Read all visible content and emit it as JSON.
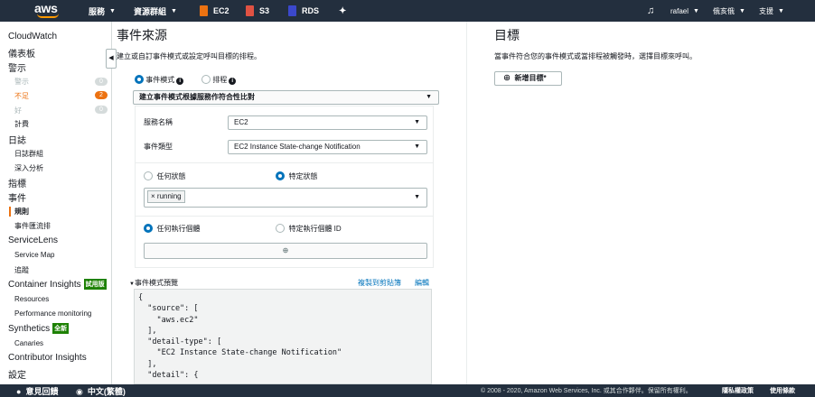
{
  "topbar": {
    "logo": "aws",
    "services": "服務",
    "resource_groups": "資源群組",
    "pins": [
      {
        "label": "EC2",
        "color": "#ec7211"
      },
      {
        "label": "S3",
        "color": "#e05243"
      },
      {
        "label": "RDS",
        "color": "#3b48cc"
      }
    ],
    "user": "rafael",
    "region": "俄亥俄",
    "support": "支援"
  },
  "sidebar": {
    "cloudwatch": "CloudWatch",
    "dashboards": "儀表板",
    "alarms": "警示",
    "alarm_states": [
      {
        "label": "警示",
        "count": "0"
      },
      {
        "label": "不足",
        "count": "2"
      },
      {
        "label": "好",
        "count": "0"
      }
    ],
    "billing": "計費",
    "logs": "日誌",
    "log_groups": "日誌群組",
    "insights": "深入分析",
    "metrics": "指標",
    "events": "事件",
    "rules": "規則",
    "event_buses": "事件匯流排",
    "servicelens": "ServiceLens",
    "service_map": "Service Map",
    "traces": "追蹤",
    "container_insights": "Container Insights",
    "container_badge": "試用版",
    "resources": "Resources",
    "performance_monitoring": "Performance monitoring",
    "synthetics": "Synthetics",
    "synthetics_badge": "全新",
    "canaries": "Canaries",
    "contributor_insights": "Contributor Insights",
    "settings": "設定"
  },
  "source": {
    "title": "事件來源",
    "description": "建立或自訂事件模式或設定呼叫目標的排程。",
    "option_pattern": "事件模式",
    "option_schedule": "排程",
    "pattern_select": "建立事件模式根據服務作符合性比對",
    "service_name_label": "服務名稱",
    "service_name_value": "EC2",
    "event_type_label": "事件類型",
    "event_type_value": "EC2 Instance State-change Notification",
    "any_state": "任何狀態",
    "specific_state": "特定狀態",
    "state_token": "running",
    "any_instance": "任何執行個體",
    "specific_instance": "特定執行個體 ID",
    "add_icon": "plus-icon",
    "preview_title": "事件模式預覽",
    "copy_link": "複製到剪貼簿",
    "edit_link": "編輯",
    "pattern_lines": [
      "{",
      "  \"source\": [",
      "    \"aws.ec2\"",
      "  ],",
      "  \"detail-type\": [",
      "    \"EC2 Instance State-change Notification\"",
      "  ],",
      "  \"detail\": {"
    ]
  },
  "targets": {
    "title": "目標",
    "description": "當事件符合您的事件模式或當排程被觸發時，選擇目標來呼叫。",
    "add_target": "新增目標*"
  },
  "footer": {
    "feedback": "意見回饋",
    "language": "中文(繁體)",
    "copyright": "© 2008 - 2020, Amazon Web Services, Inc. 或其合作夥伴。保留所有權利。",
    "privacy": "隱私權政策",
    "terms": "使用條款"
  }
}
